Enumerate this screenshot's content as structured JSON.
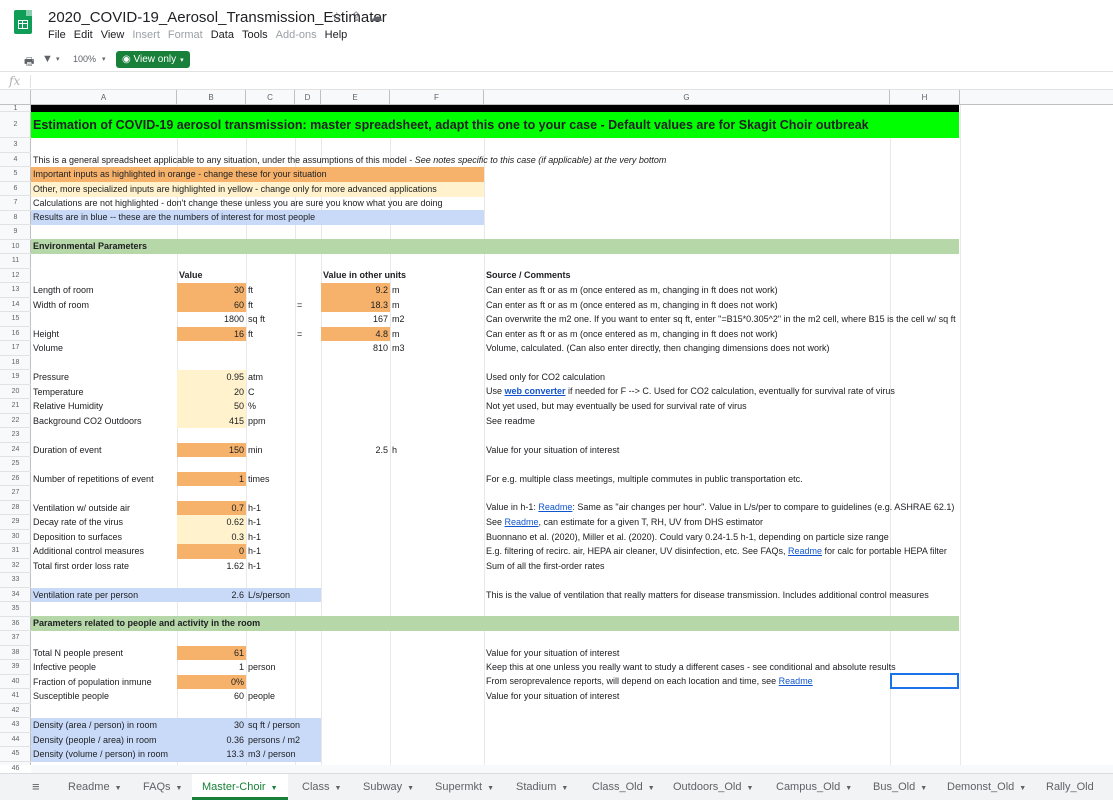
{
  "doc": {
    "title": "2020_COVID-19_Aerosol_Transmission_Estimator"
  },
  "menu": [
    "File",
    "Edit",
    "View",
    "Insert",
    "Format",
    "Data",
    "Tools",
    "Add-ons",
    "Help"
  ],
  "menu_disabled": [
    false,
    false,
    false,
    true,
    true,
    false,
    false,
    true,
    false
  ],
  "toolbar": {
    "zoom": "100%",
    "view_only": "View only"
  },
  "fx": "fx",
  "columns": [
    "A",
    "B",
    "C",
    "D",
    "E",
    "F",
    "G",
    "H"
  ],
  "rows": {
    "r2": "Estimation of COVID-19 aerosol transmission: master spreadsheet, adapt this one to your case - Default values are for Skagit Choir outbreak",
    "r4a": "This is a general spreadsheet applicable to any situation, under the assumptions of this model - ",
    "r4b": "See notes specific to this case (if applicable) at the very bottom",
    "r5": "Important inputs as highlighted in orange - change these for your situation",
    "r6": "Other, more specialized inputs are highlighted in yellow - change only for more advanced applications",
    "r7": "Calculations are not highlighted - don't change these unless you are sure you know what you are doing",
    "r8": "Results are in blue -- these are the numbers of interest for most people",
    "r10": "Environmental Parameters",
    "r12_value": "Value",
    "r12_other": "Value in other units",
    "r12_source": "Source / Comments",
    "r36": "Parameters related to people and activity in the room"
  },
  "params": [
    {
      "row": 13,
      "label": "Length of room",
      "value": "30",
      "unit": "ft",
      "eq": "",
      "val2": "9.2",
      "unit2": "m",
      "comment": "Can enter as ft or as m (once entered as m, changing in ft does not work)"
    },
    {
      "row": 14,
      "label": "Width of room",
      "value": "60",
      "unit": "ft",
      "eq": "=",
      "val2": "18.3",
      "unit2": "m",
      "comment": "Can enter as ft or as m (once entered as m, changing in ft does not work)"
    },
    {
      "row": 15,
      "label": "",
      "value": "1800",
      "unit": "sq ft",
      "eq": "",
      "val2": "167",
      "unit2": "m2",
      "comment": "Can overwrite the m2 one. If you want to enter sq ft, enter \"=B15*0.305^2\" in the m2 cell, where B15 is the cell w/ sq ft"
    },
    {
      "row": 16,
      "label": "Height",
      "value": "16",
      "unit": "ft",
      "eq": "=",
      "val2": "4.8",
      "unit2": "m",
      "comment": "Can enter as ft or as m (once entered as m, changing in ft does not work)"
    },
    {
      "row": 17,
      "label": "Volume",
      "value": "",
      "unit": "",
      "eq": "",
      "val2": "810",
      "unit2": "m3",
      "comment": "Volume, calculated. (Can also enter directly, then changing dimensions does not work)"
    },
    {
      "row": 19,
      "label": "Pressure",
      "value": "0.95",
      "unit": "atm",
      "eq": "",
      "val2": "",
      "unit2": "",
      "comment": "Used only for CO2 calculation"
    },
    {
      "row": 20,
      "label": "Temperature",
      "value": "20",
      "unit": "C",
      "eq": "",
      "val2": "",
      "unit2": "",
      "comment": ""
    },
    {
      "row": 21,
      "label": "Relative Humidity",
      "value": "50",
      "unit": "%",
      "eq": "",
      "val2": "",
      "unit2": "",
      "comment": "Not yet used, but may eventually be used for survival rate of virus"
    },
    {
      "row": 22,
      "label": "Background CO2 Outdoors",
      "value": "415",
      "unit": "ppm",
      "eq": "",
      "val2": "",
      "unit2": "",
      "comment": "See readme"
    },
    {
      "row": 24,
      "label": "Duration of event",
      "value": "150",
      "unit": "min",
      "eq": "",
      "val2": "2.5",
      "unit2": "h",
      "comment": "Value for your situation of interest"
    },
    {
      "row": 26,
      "label": "Number of repetitions of event",
      "value": "1",
      "unit": "times",
      "eq": "",
      "val2": "",
      "unit2": "",
      "comment": "For e.g. multiple class meetings, multiple commutes in public transportation etc."
    },
    {
      "row": 28,
      "label": "Ventilation w/ outside air",
      "value": "0.7",
      "unit": "h-1",
      "eq": "",
      "val2": "",
      "unit2": "",
      "comment": ""
    },
    {
      "row": 29,
      "label": "Decay rate of the virus",
      "value": "0.62",
      "unit": "h-1",
      "eq": "",
      "val2": "",
      "unit2": "",
      "comment": ""
    },
    {
      "row": 30,
      "label": "Deposition to surfaces",
      "value": "0.3",
      "unit": "h-1",
      "eq": "",
      "val2": "",
      "unit2": "",
      "comment": "Buonnano et al. (2020), Miller et al. (2020). Could vary 0.24-1.5 h-1, depending on particle size range"
    },
    {
      "row": 31,
      "label": "Additional control measures",
      "value": "0",
      "unit": "h-1",
      "eq": "",
      "val2": "",
      "unit2": "",
      "comment": ""
    },
    {
      "row": 32,
      "label": "Total first order loss rate",
      "value": "1.62",
      "unit": "h-1",
      "eq": "",
      "val2": "",
      "unit2": "",
      "comment": "Sum of all the first-order rates"
    },
    {
      "row": 34,
      "label": "Ventilation rate per person",
      "value": "2.6",
      "unit": "L/s/person",
      "eq": "",
      "val2": "",
      "unit2": "",
      "comment": "This is the value of ventilation that really matters for disease transmission. Includes additional control measures"
    },
    {
      "row": 38,
      "label": "Total N people present",
      "value": "61",
      "unit": "",
      "eq": "",
      "val2": "",
      "unit2": "",
      "comment": "Value for your situation of interest"
    },
    {
      "row": 39,
      "label": "Infective people",
      "value": "1",
      "unit": "person",
      "eq": "",
      "val2": "",
      "unit2": "",
      "comment": "Keep this at one unless you really want to study a different cases - see conditional and absolute results"
    },
    {
      "row": 40,
      "label": "Fraction of population inmune",
      "value": "0%",
      "unit": "",
      "eq": "",
      "val2": "",
      "unit2": "",
      "comment": ""
    },
    {
      "row": 41,
      "label": "Susceptible people",
      "value": "60",
      "unit": "people",
      "eq": "",
      "val2": "",
      "unit2": "",
      "comment": "Value for your situation of interest"
    },
    {
      "row": 43,
      "label": "Density (area / person) in room",
      "value": "30",
      "unit": "sq ft / person",
      "eq": "",
      "val2": "",
      "unit2": "",
      "comment": ""
    },
    {
      "row": 44,
      "label": "Density (people / area) in room",
      "value": "0.36",
      "unit": "persons / m2",
      "eq": "",
      "val2": "",
      "unit2": "",
      "comment": ""
    },
    {
      "row": 45,
      "label": "Density (volume / person) in room",
      "value": "13.3",
      "unit": "m3 / person",
      "eq": "",
      "val2": "",
      "unit2": "",
      "comment": ""
    }
  ],
  "link_comments": {
    "r20a": "Use ",
    "r20link": "web converter",
    "r20b": " if needed for F --> C. Used for CO2 calculation, eventually for survival rate of virus",
    "r28a": "Value in h-1: ",
    "r28link": "Readme",
    "r28b": ": Same as \"air changes per hour\". Value in L/s/per to compare to guidelines (e.g. ASHRAE 62.1)",
    "r29a": "See ",
    "r29link": "Readme",
    "r29b": ", can estimate for a given T, RH, UV from DHS estimator",
    "r31a": "E.g. filtering of recirc. air, HEPA air cleaner, UV disinfection, etc. See FAQs, ",
    "r31link": "Readme",
    "r31b": " for calc for portable HEPA filter",
    "r40a": "From seroprevalence reports, will depend on each location and time, see ",
    "r40link": "Readme"
  },
  "tabs": [
    "Readme",
    "FAQs",
    "Master-Choir",
    "Class",
    "Subway",
    "Supermkt",
    "Stadium",
    "Class_Old",
    "Outdoors_Old",
    "Campus_Old",
    "Bus_Old",
    "Demonst_Old",
    "Rally_Old"
  ],
  "active_tab": "Master-Choir"
}
